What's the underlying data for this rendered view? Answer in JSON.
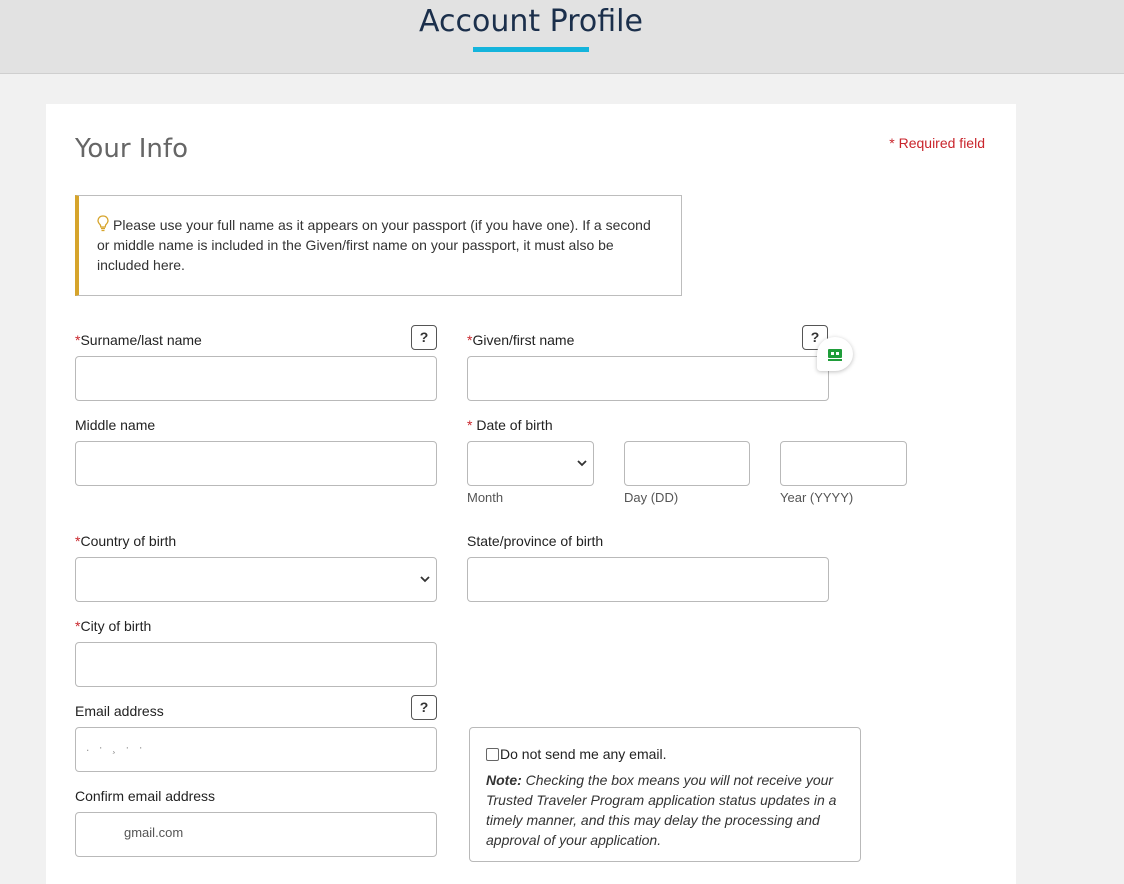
{
  "header": {
    "title": "Account Profile"
  },
  "section": {
    "title": "Your Info",
    "required_note": "* Required field"
  },
  "notice": {
    "icon": "lightbulb-icon",
    "text": "Please use your full name as it appears on your passport (if you have one). If a second or middle name is included in the Given/first name on your passport, it must also be included here."
  },
  "fields": {
    "required_marker": "*",
    "surname": {
      "label": "Surname/last name",
      "value": "",
      "help": "?"
    },
    "given": {
      "label": "Given/first name",
      "value": "",
      "help": "?"
    },
    "middle": {
      "label": "Middle name",
      "value": ""
    },
    "dob": {
      "label": "Date of birth",
      "month_label": "Month",
      "day_label": "Day (DD)",
      "year_label": "Year (YYYY)",
      "month_value": "",
      "day_value": "",
      "year_value": ""
    },
    "country": {
      "label": "Country of birth",
      "value": ""
    },
    "state": {
      "label": "State/province of birth",
      "value": ""
    },
    "city": {
      "label": "City of birth",
      "value": ""
    },
    "email": {
      "label": "Email address",
      "value": "",
      "help": "?"
    },
    "confirm_email": {
      "label": "Confirm email address",
      "value_visible": "gmail.com"
    }
  },
  "email_opt_out": {
    "checkbox_label": "Do not send me any email.",
    "checked": false,
    "note_label": "Note:",
    "note_text": "Checking the box means you will not receive your Trusted Traveler Program application status updates in a timely manner, and this may delay the processing and approval of your application."
  },
  "colors": {
    "accent": "#14b4dc",
    "required": "#c9252c",
    "notice_border": "#d6a42b",
    "title": "#1b2f4b"
  }
}
